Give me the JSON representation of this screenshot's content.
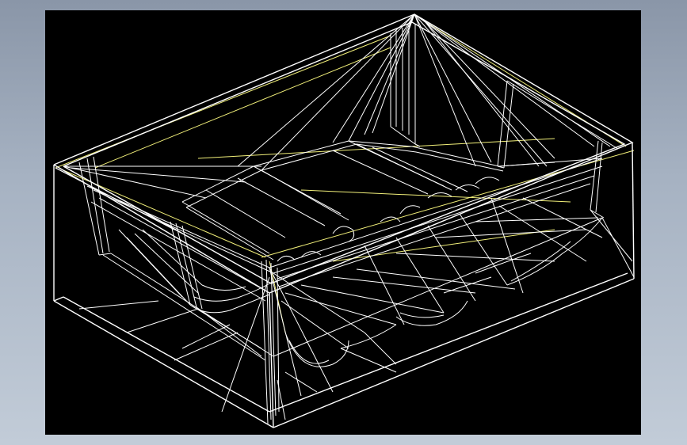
{
  "view": {
    "background_color": "#000000",
    "frame_gradient_top": "#8a96a8",
    "frame_gradient_bottom": "#c2ccd8",
    "edge_color": "#ffffff",
    "construction_line_color": "#f2f07a",
    "render_mode": "wireframe"
  }
}
